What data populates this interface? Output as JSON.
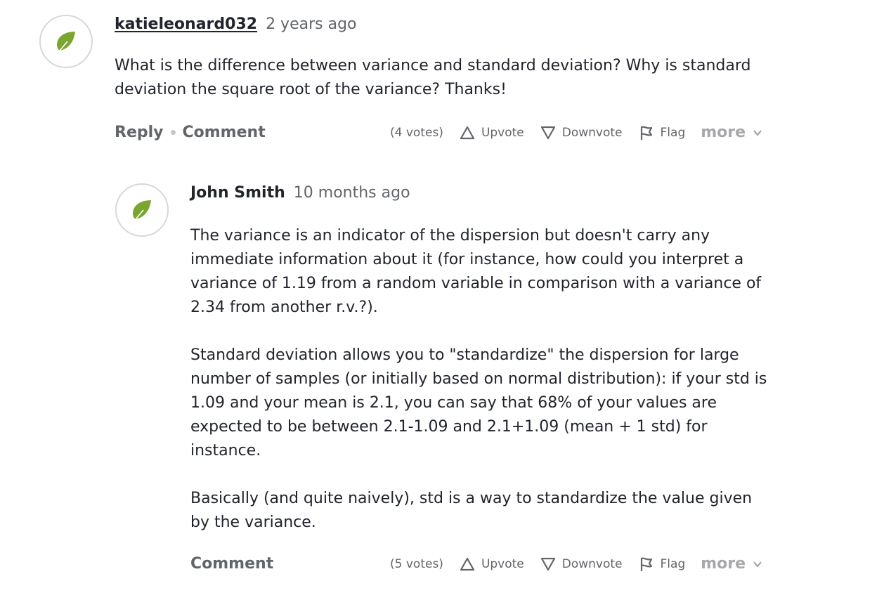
{
  "question": {
    "author": "katieleonard032",
    "age": "2 years ago",
    "text": "What is the difference between variance and standard deviation? Why is standard deviation the square root of the variance? Thanks!",
    "reply_label": "Reply",
    "comment_label": "Comment",
    "votes": "(4 votes)",
    "upvote_label": "Upvote",
    "downvote_label": "Downvote",
    "flag_label": "Flag",
    "more_label": "more"
  },
  "answer": {
    "author": "John Smith",
    "age": "10 months ago",
    "paragraphs": [
      "The variance is an indicator of the dispersion but doesn't carry any immediate information about it (for instance, how could you interpret a variance of 1.19 from a random variable in comparison with a variance of 2.34 from another r.v.?).",
      "Standard deviation allows you to \"standardize\" the dispersion for large number of samples (or initially based on normal distribution): if your std is 1.09 and your mean is 2.1, you can say that 68% of your values are expected to be between 2.1-1.09 and 2.1+1.09 (mean + 1 std) for instance.",
      "Basically (and quite naively), std is a way to standardize the value given by the variance."
    ],
    "comment_label": "Comment",
    "votes": "(5 votes)",
    "upvote_label": "Upvote",
    "downvote_label": "Downvote",
    "flag_label": "Flag",
    "more_label": "more"
  },
  "colors": {
    "leaf": "#7aa52f",
    "text": "#21242c",
    "muted": "#626569",
    "more": "#a6a8ab"
  },
  "icons": {
    "avatar": "leaf-icon",
    "upvote": "triangle-up-icon",
    "downvote": "triangle-down-icon",
    "flag": "flag-icon",
    "more": "chevron-down-icon"
  }
}
